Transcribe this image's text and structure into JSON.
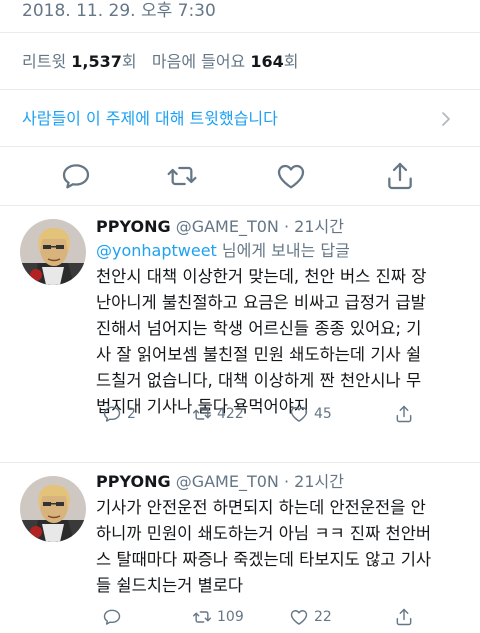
{
  "tweet": {
    "timestamp": "2018. 11. 29. 오후 7:30",
    "retweet_label": "리트윗",
    "retweet_count": "1,537",
    "retweet_unit": "회",
    "like_label": "마음에 들어요",
    "like_count": "164",
    "like_unit": "회",
    "activity_link": "사람들이 이 주제에 대해 트윗했습니다"
  },
  "icons": {
    "reply": "reply-icon",
    "retweet": "retweet-icon",
    "like": "heart-icon",
    "share": "share-icon",
    "chevron": "chevron-right-icon"
  },
  "colors": {
    "link": "#1da1f2",
    "muted": "#657786",
    "text": "#14171a",
    "divider": "#e6ecf0"
  },
  "replies": [
    {
      "display_name": "PPYONG",
      "handle": "@GAME_T0N",
      "time": "· 21시간",
      "reply_to_handle": "@yonhaptweet",
      "reply_to_suffix": " 님에게 보내는 답글",
      "text": "천안시 대책 이상한거 맞는데, 천안 버스 진짜 장\n난아니게 불친절하고 요금은 비싸고 급정거 급발\n진해서 넘어지는 학생 어르신들 종종 있어요; 기\n사 잘 읽어보셈 불친절 민원 쇄도하는데 기사 쉴\n드칠거 없습니다, 대책 이상하게 짠 천안시나 무\n법지대 기사나 둘다 욕먹어야지",
      "reply_count": "2",
      "retweet_count": "422",
      "like_count": "45"
    },
    {
      "display_name": "PPYONG",
      "handle": "@GAME_T0N",
      "time": "· 21시간",
      "text": "기사가 안전운전 하면되지 하는데 안전운전을 안\n하니까 민원이 쇄도하는거 아님 ㅋㅋ 진짜 천안버\n스 탈때마다 짜증나 죽겠는데 타보지도 않고 기사\n들 쉴드치는거 별로다",
      "reply_count": "",
      "retweet_count": "109",
      "like_count": "22"
    }
  ]
}
